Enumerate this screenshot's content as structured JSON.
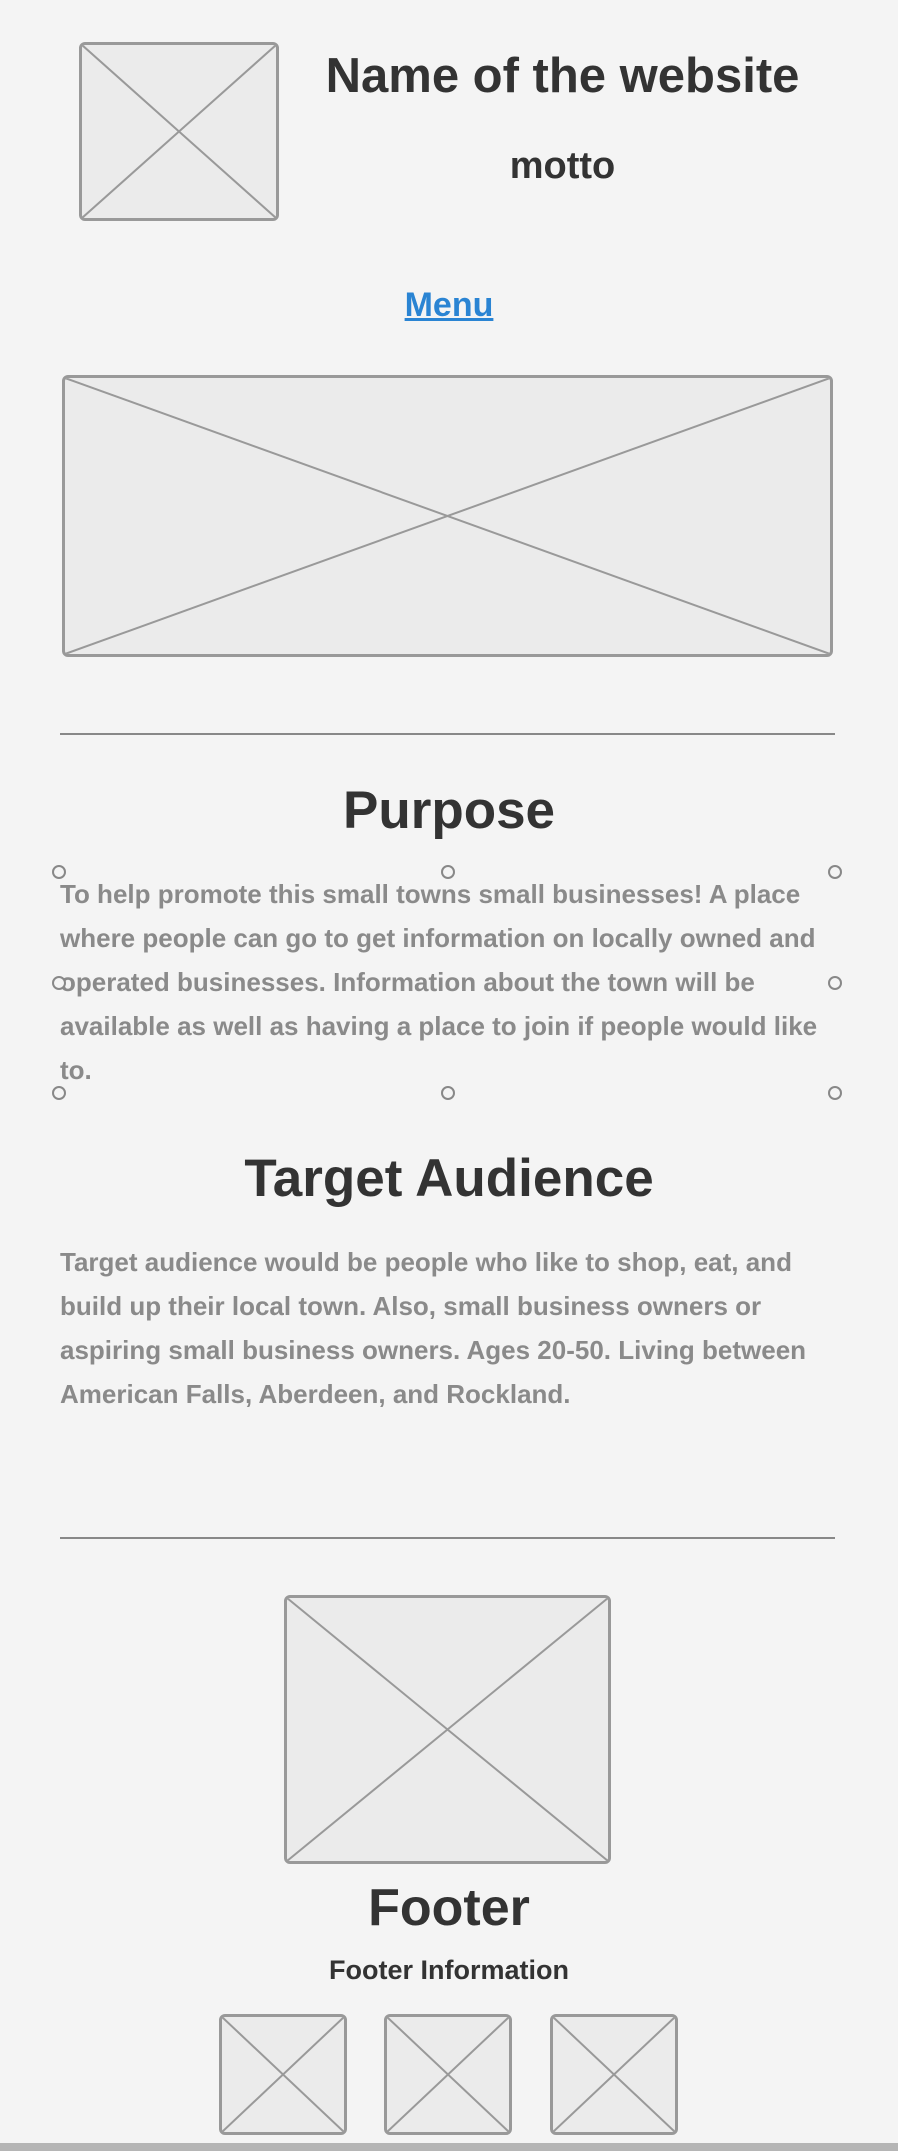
{
  "header": {
    "site_name": "Name of the website",
    "motto": "motto",
    "menu_label": "Menu"
  },
  "purpose": {
    "heading": "Purpose",
    "text": "To help promote this small towns small businesses! A place where people can go to get information on locally owned and operated businesses. Information about the town will be available as well as having a place to join if people would like to."
  },
  "audience": {
    "heading": "Target Audience",
    "text": "Target audience would be people who like to shop, eat, and build up their local town. Also, small business owners or aspiring small business owners. Ages 20-50. Living between American Falls, Aberdeen, and Rockland."
  },
  "footer": {
    "heading": "Footer",
    "info": "Footer Information"
  },
  "colors": {
    "background": "#f4f4f4",
    "link": "#2a84d3",
    "placeholder_stroke": "#999999",
    "muted_text": "#8a8a8a"
  }
}
